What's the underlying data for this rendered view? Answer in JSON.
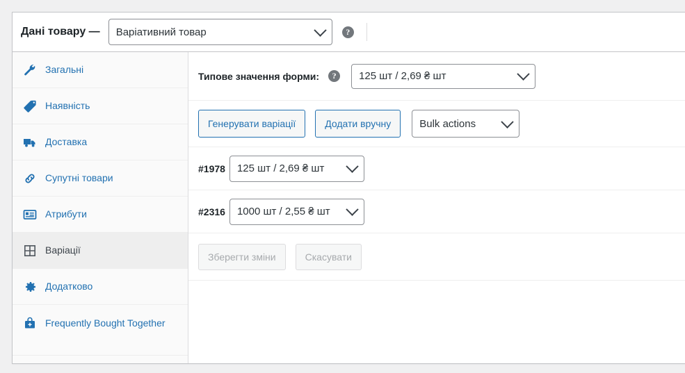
{
  "header": {
    "title": "Дані товару —",
    "product_type": {
      "selected": "Варіативний товар",
      "icon": "chevron-down-icon"
    },
    "help_icon": "?"
  },
  "sidebar": {
    "items": [
      {
        "label": "Загальні",
        "icon": "wrench-icon",
        "active": false
      },
      {
        "label": "Наявність",
        "icon": "inventory-icon",
        "active": false
      },
      {
        "label": "Доставка",
        "icon": "truck-icon",
        "active": false
      },
      {
        "label": "Супутні товари",
        "icon": "link-icon",
        "active": false
      },
      {
        "label": "Атрибути",
        "icon": "attributes-icon",
        "active": false
      },
      {
        "label": "Варіації",
        "icon": "grid-icon",
        "active": true
      },
      {
        "label": "Додатково",
        "icon": "gear-icon",
        "active": false
      },
      {
        "label": "Frequently Bought Together",
        "icon": "bag-plus-icon",
        "active": false
      }
    ]
  },
  "main": {
    "defaults": {
      "label": "Типове значення форми:",
      "help_icon": "?",
      "selected": "125 шт / 2,69 ₴ шт"
    },
    "toolbar": {
      "generate_label": "Генерувати варіації",
      "add_manually_label": "Додати вручну",
      "bulk_actions_label": "Bulk actions"
    },
    "variations": [
      {
        "id": "#1978",
        "selected": "125 шт / 2,69 ₴ шт"
      },
      {
        "id": "#2316",
        "selected": "1000 шт / 2,55 ₴ шт"
      }
    ],
    "actions": {
      "save_label": "Зберегти зміни",
      "cancel_label": "Скасувати"
    }
  },
  "colors": {
    "link": "#2271b1",
    "page_bg": "#f0f0f1",
    "panel_bg": "#ffffff",
    "active_tab_bg": "#eeeeee",
    "border": "#c3c4c7"
  }
}
